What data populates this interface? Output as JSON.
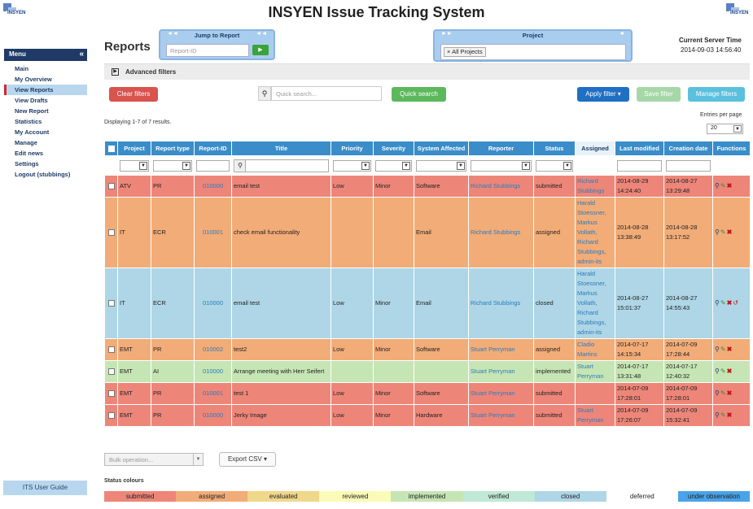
{
  "app": {
    "title": "INSYEN Issue Tracking System",
    "logo_text": "INSYEN"
  },
  "menu": {
    "title": "Menu",
    "items": [
      {
        "label": "Main",
        "active": false
      },
      {
        "label": "My Overview",
        "active": false
      },
      {
        "label": "View Reports",
        "active": true
      },
      {
        "label": "View Drafts",
        "active": false
      },
      {
        "label": "New Report",
        "active": false
      },
      {
        "label": "Statistics",
        "active": false
      },
      {
        "label": "My Account",
        "active": false
      },
      {
        "label": "Manage",
        "active": false
      },
      {
        "label": "Edit news",
        "active": false
      },
      {
        "label": "Settings",
        "active": false
      },
      {
        "label": "Logout (stubbings)",
        "active": false
      }
    ],
    "guide_label": "ITS User Guide"
  },
  "page": {
    "title": "Reports"
  },
  "jump": {
    "title": "Jump to Report",
    "placeholder": "Report-ID"
  },
  "project": {
    "title": "Project",
    "selected": "All Projects"
  },
  "server": {
    "label": "Current Server Time",
    "time": "2014-09-03 14:56:40"
  },
  "filters": {
    "advanced_label": "Advanced filters",
    "clear_label": "Clear filters",
    "search_placeholder": "Quick search...",
    "quick_label": "Quick search",
    "apply_label": "Apply filter",
    "save_label": "Save filter",
    "manage_label": "Manage filters"
  },
  "results": {
    "displaying": "Displaying 1-7 of 7 results.",
    "entries_label": "Entries per page",
    "entries_value": "20"
  },
  "table": {
    "headers": [
      "Project",
      "Report type",
      "Report-ID",
      "Title",
      "Priority",
      "Severity",
      "System Affected",
      "Reporter",
      "Status",
      "Assigned",
      "Last modified",
      "Creation date",
      "Functions"
    ],
    "rows": [
      {
        "status_class": "submitted",
        "project": "ATV",
        "type": "PR",
        "id": "010000",
        "title": "email test",
        "priority": "Low",
        "severity": "Minor",
        "system": "Software",
        "reporter": "Richard Stubbings",
        "status": "submitted",
        "assigned": [
          "Richard",
          "Stubbings"
        ],
        "modified": [
          "2014-08-29",
          "14:24:40"
        ],
        "created": [
          "2014-08-27",
          "13:29:48"
        ],
        "undo": false
      },
      {
        "status_class": "assigned",
        "project": "IT",
        "type": "ECR",
        "id": "010001",
        "title": "check email functionality",
        "priority": "",
        "severity": "",
        "system": "Email",
        "reporter": "Richard Stubbings",
        "status": "assigned",
        "assigned": [
          "Harald",
          "Stoessner,",
          "Markus",
          "Vollath,",
          "Richard",
          "Stubbings,",
          "admin-its"
        ],
        "modified": [
          "2014-08-28",
          "13:38:49"
        ],
        "created": [
          "2014-08-28",
          "13:17:52"
        ],
        "undo": false
      },
      {
        "status_class": "closed",
        "project": "IT",
        "type": "ECR",
        "id": "010000",
        "title": "email test",
        "priority": "Low",
        "severity": "Minor",
        "system": "Email",
        "reporter": "Richard Stubbings",
        "status": "closed",
        "assigned": [
          "Harald",
          "Stoessner,",
          "Markus",
          "Vollath,",
          "Richard",
          "Stubbings,",
          "admin-its"
        ],
        "modified": [
          "2014-08-27",
          "15:01:37"
        ],
        "created": [
          "2014-08-27",
          "14:55:43"
        ],
        "undo": true
      },
      {
        "status_class": "assigned",
        "project": "EMT",
        "type": "PR",
        "id": "010002",
        "title": "test2",
        "priority": "Low",
        "severity": "Minor",
        "system": "Software",
        "reporter": "Stuart Perryman",
        "status": "assigned",
        "assigned": [
          "Cladio",
          "Martins"
        ],
        "modified": [
          "2014-07-17",
          "14:15:34"
        ],
        "created": [
          "2014-07-09",
          "17:28:44"
        ],
        "undo": false
      },
      {
        "status_class": "implemented",
        "project": "EMT",
        "type": "AI",
        "id": "010000",
        "title": "Arrange meeting with Herr Seifert",
        "priority": "",
        "severity": "",
        "system": "",
        "reporter": "Stuart Perryman",
        "status": "implemented",
        "assigned": [
          "Stuart",
          "Perryman"
        ],
        "modified": [
          "2014-07-17",
          "13:31:48"
        ],
        "created": [
          "2014-07-17",
          "12:40:32"
        ],
        "undo": false
      },
      {
        "status_class": "submitted",
        "project": "EMT",
        "type": "PR",
        "id": "010001",
        "title": "test 1",
        "priority": "Low",
        "severity": "Minor",
        "system": "Software",
        "reporter": "Stuart Perryman",
        "status": "submitted",
        "assigned": [],
        "modified": [
          "2014-07-09",
          "17:28:01"
        ],
        "created": [
          "2014-07-09",
          "17:28:01"
        ],
        "undo": false
      },
      {
        "status_class": "submitted",
        "project": "EMT",
        "type": "PR",
        "id": "010000",
        "title": "Jerky Image",
        "priority": "Low",
        "severity": "Minor",
        "system": "Hardware",
        "reporter": "Stuart Perryman",
        "status": "submitted",
        "assigned": [
          "Stuart",
          "Perryman"
        ],
        "modified": [
          "2014-07-09",
          "17:26:07"
        ],
        "created": [
          "2014-07-09",
          "15:32:41"
        ],
        "undo": false
      }
    ]
  },
  "bottom": {
    "bulk_placeholder": "Bulk operation...",
    "export_label": "Export CSV"
  },
  "status_legend": {
    "title": "Status colours",
    "items": [
      {
        "label": "submitted",
        "color": "#ed8679"
      },
      {
        "label": "assigned",
        "color": "#f2ac78"
      },
      {
        "label": "evaluated",
        "color": "#f0d88a"
      },
      {
        "label": "reviewed",
        "color": "#fbfbb8"
      },
      {
        "label": "implemented",
        "color": "#c6e5b4"
      },
      {
        "label": "verified",
        "color": "#bfe8d8"
      },
      {
        "label": "closed",
        "color": "#aed6e6"
      },
      {
        "label": "deferred",
        "color": "#ffffff"
      },
      {
        "label": "under observation",
        "color": "#4aa3e8"
      }
    ]
  }
}
